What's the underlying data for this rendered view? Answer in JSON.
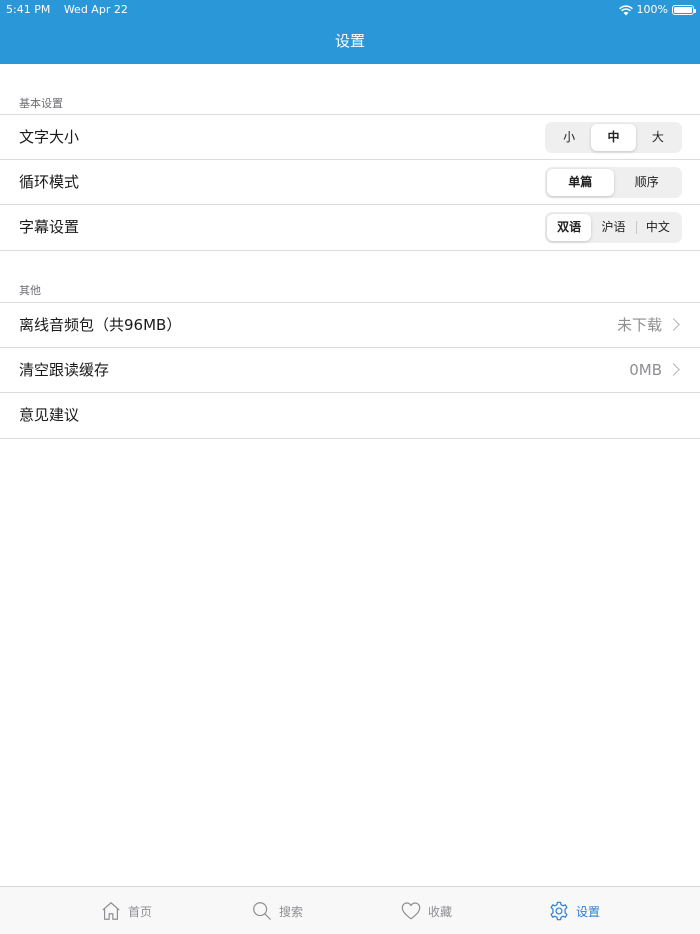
{
  "status_bar": {
    "time": "5:41 PM",
    "date": "Wed Apr 22",
    "battery": "100%"
  },
  "nav": {
    "title": "设置"
  },
  "sections": {
    "basic": {
      "header": "基本设置",
      "font_size": {
        "label": "文字大小",
        "options": [
          "小",
          "中",
          "大"
        ],
        "selected": "中"
      },
      "loop_mode": {
        "label": "循环模式",
        "options": [
          "单篇",
          "顺序"
        ],
        "selected": "单篇"
      },
      "subtitle": {
        "label": "字幕设置",
        "options": [
          "双语",
          "沪语",
          "中文"
        ],
        "selected": "双语"
      }
    },
    "other": {
      "header": "其他",
      "offline_audio": {
        "label": "离线音频包（共96MB）",
        "value": "未下载"
      },
      "clear_cache": {
        "label": "清空跟读缓存",
        "value": "0MB"
      },
      "feedback": {
        "label": "意见建议"
      }
    }
  },
  "tabbar": {
    "items": [
      {
        "label": "首页",
        "icon": "home-icon"
      },
      {
        "label": "搜索",
        "icon": "search-icon"
      },
      {
        "label": "收藏",
        "icon": "heart-icon"
      },
      {
        "label": "设置",
        "icon": "gear-icon"
      }
    ],
    "active": "设置",
    "active_color": "#2a7fd0",
    "inactive_color": "#8e8e93"
  },
  "colors": {
    "nav_background": "#2a97d9"
  }
}
